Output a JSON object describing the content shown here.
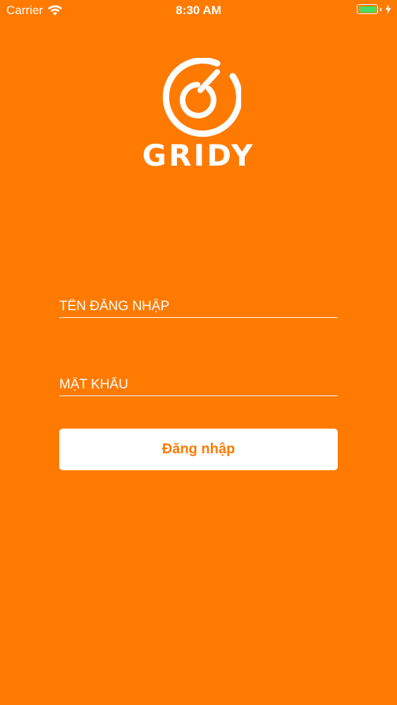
{
  "status_bar": {
    "carrier": "Carrier",
    "time": "8:30 AM",
    "wifi_icon": "wifi-icon",
    "battery_icon": "battery-icon",
    "charging_icon": "bolt-icon",
    "battery_color": "#4CD964"
  },
  "brand": {
    "name": "GRIDY",
    "logo_icon": "gridy-logo-icon"
  },
  "form": {
    "username_placeholder": "TÊN ĐĂNG NHẬP",
    "password_placeholder": "MẬT KHẨU",
    "login_label": "Đăng nhập"
  },
  "colors": {
    "background": "#FF7A00",
    "button_bg": "#FFFFFF",
    "button_text": "#FF7A00"
  }
}
